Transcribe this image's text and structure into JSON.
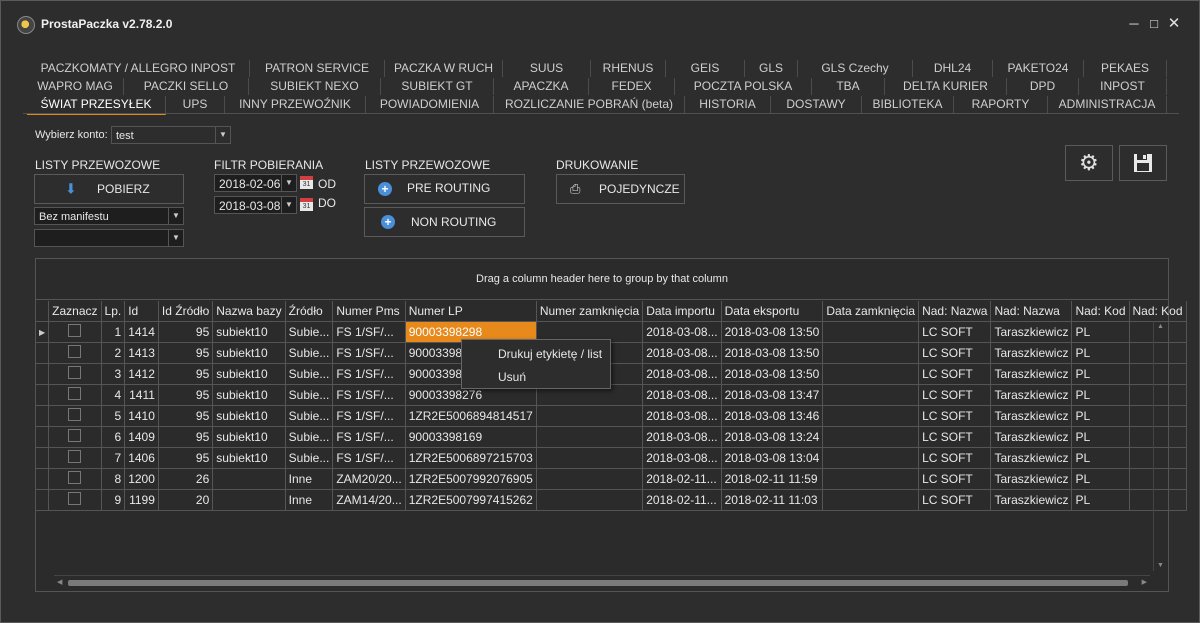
{
  "app": {
    "title": "ProstaPaczka v2.78.2.0"
  },
  "tabs": {
    "row1": [
      "PACZKOMATY / ALLEGRO INPOST",
      "PATRON SERVICE",
      "PACZKA W RUCH",
      "SUUS",
      "RHENUS",
      "GEIS",
      "GLS",
      "GLS Czechy",
      "DHL24",
      "PAKETO24",
      "PEKAES"
    ],
    "row2": [
      "WAPRO MAG",
      "PACZKI SELLO",
      "SUBIEKT NEXO",
      "SUBIEKT GT",
      "APACZKA",
      "FEDEX",
      "POCZTA POLSKA",
      "TBA",
      "DELTA KURIER",
      "DPD",
      "INPOST"
    ],
    "row3": [
      "ŚWIAT PRZESYŁEK",
      "UPS",
      "INNY PRZEWOŹNIK",
      "POWIADOMIENIA",
      "ROZLICZANIE POBRAŃ (beta)",
      "HISTORIA",
      "DOSTAWY",
      "BIBLIOTEKA",
      "RAPORTY",
      "ADMINISTRACJA"
    ]
  },
  "account": {
    "label": "Wybierz konto:",
    "value": "test"
  },
  "lists": {
    "header": "LISTY PRZEWOZOWE",
    "download_label": "POBIERZ",
    "manifest_value": "Bez manifestu",
    "second_value": ""
  },
  "filter": {
    "header": "FILTR POBIERANIA",
    "from": "2018-02-06",
    "from_label": "OD",
    "to": "2018-03-08",
    "to_label": "DO",
    "cal_day": "31"
  },
  "routing": {
    "header": "LISTY PRZEWOZOWE",
    "pre": "PRE ROUTING",
    "non": "NON ROUTING"
  },
  "print": {
    "header": "DRUKOWANIE",
    "single": "POJEDYNCZE"
  },
  "grid": {
    "group_hint": "Drag a column header here to group by that column",
    "columns": [
      "Zaznacz",
      "Lp.",
      "Id",
      "Id Źródło",
      "Nazwa bazy",
      "Źródło",
      "Numer Pms",
      "Numer LP",
      "Numer zamknięcia",
      "Data importu",
      "Data eksportu",
      "Data zamknięcia",
      "Nad: Nazwa",
      "Nad: Nazwa",
      "Nad: Kod",
      "Nad: Kod"
    ],
    "rows": [
      [
        "",
        "1",
        "1414",
        "95",
        "subiekt10",
        "Subie...",
        "FS 1/SF/...",
        "90003398298",
        "",
        "2018-03-08...",
        "2018-03-08 13:50",
        "",
        "LC SOFT",
        "Taraszkiewicz",
        "PL",
        ""
      ],
      [
        "",
        "2",
        "1413",
        "95",
        "subiekt10",
        "Subie...",
        "FS 1/SF/...",
        "9000339829",
        "",
        "2018-03-08...",
        "2018-03-08 13:50",
        "",
        "LC SOFT",
        "Taraszkiewicz",
        "PL",
        ""
      ],
      [
        "",
        "3",
        "1412",
        "95",
        "subiekt10",
        "Subie...",
        "FS 1/SF/...",
        "9000339829",
        "",
        "2018-03-08...",
        "2018-03-08 13:50",
        "",
        "LC SOFT",
        "Taraszkiewicz",
        "PL",
        ""
      ],
      [
        "",
        "4",
        "1411",
        "95",
        "subiekt10",
        "Subie...",
        "FS 1/SF/...",
        "90003398276",
        "",
        "2018-03-08...",
        "2018-03-08 13:47",
        "",
        "LC SOFT",
        "Taraszkiewicz",
        "PL",
        ""
      ],
      [
        "",
        "5",
        "1410",
        "95",
        "subiekt10",
        "Subie...",
        "FS 1/SF/...",
        "1ZR2E5006894814517",
        "",
        "2018-03-08...",
        "2018-03-08 13:46",
        "",
        "LC SOFT",
        "Taraszkiewicz",
        "PL",
        ""
      ],
      [
        "",
        "6",
        "1409",
        "95",
        "subiekt10",
        "Subie...",
        "FS 1/SF/...",
        "90003398169",
        "",
        "2018-03-08...",
        "2018-03-08 13:24",
        "",
        "LC SOFT",
        "Taraszkiewicz",
        "PL",
        ""
      ],
      [
        "",
        "7",
        "1406",
        "95",
        "subiekt10",
        "Subie...",
        "FS 1/SF/...",
        "1ZR2E5006897215703",
        "",
        "2018-03-08...",
        "2018-03-08 13:04",
        "",
        "LC SOFT",
        "Taraszkiewicz",
        "PL",
        ""
      ],
      [
        "",
        "8",
        "1200",
        "26",
        "",
        "Inne",
        "ZAM20/20...",
        "1ZR2E5007992076905",
        "",
        "2018-02-11...",
        "2018-02-11 11:59",
        "",
        "LC SOFT",
        "Taraszkiewicz",
        "PL",
        ""
      ],
      [
        "",
        "9",
        "1199",
        "20",
        "",
        "Inne",
        "ZAM14/20...",
        "1ZR2E5007997415262",
        "",
        "2018-02-11...",
        "2018-02-11 11:03",
        "",
        "LC SOFT",
        "Taraszkiewicz",
        "PL",
        ""
      ]
    ]
  },
  "context_menu": {
    "print_label": "Drukuj etykietę / list",
    "delete_label": "Usuń"
  },
  "colors": {
    "accent": "#e8891c",
    "background": "#2d2d2d",
    "icon_blue": "#4a8fd8"
  }
}
